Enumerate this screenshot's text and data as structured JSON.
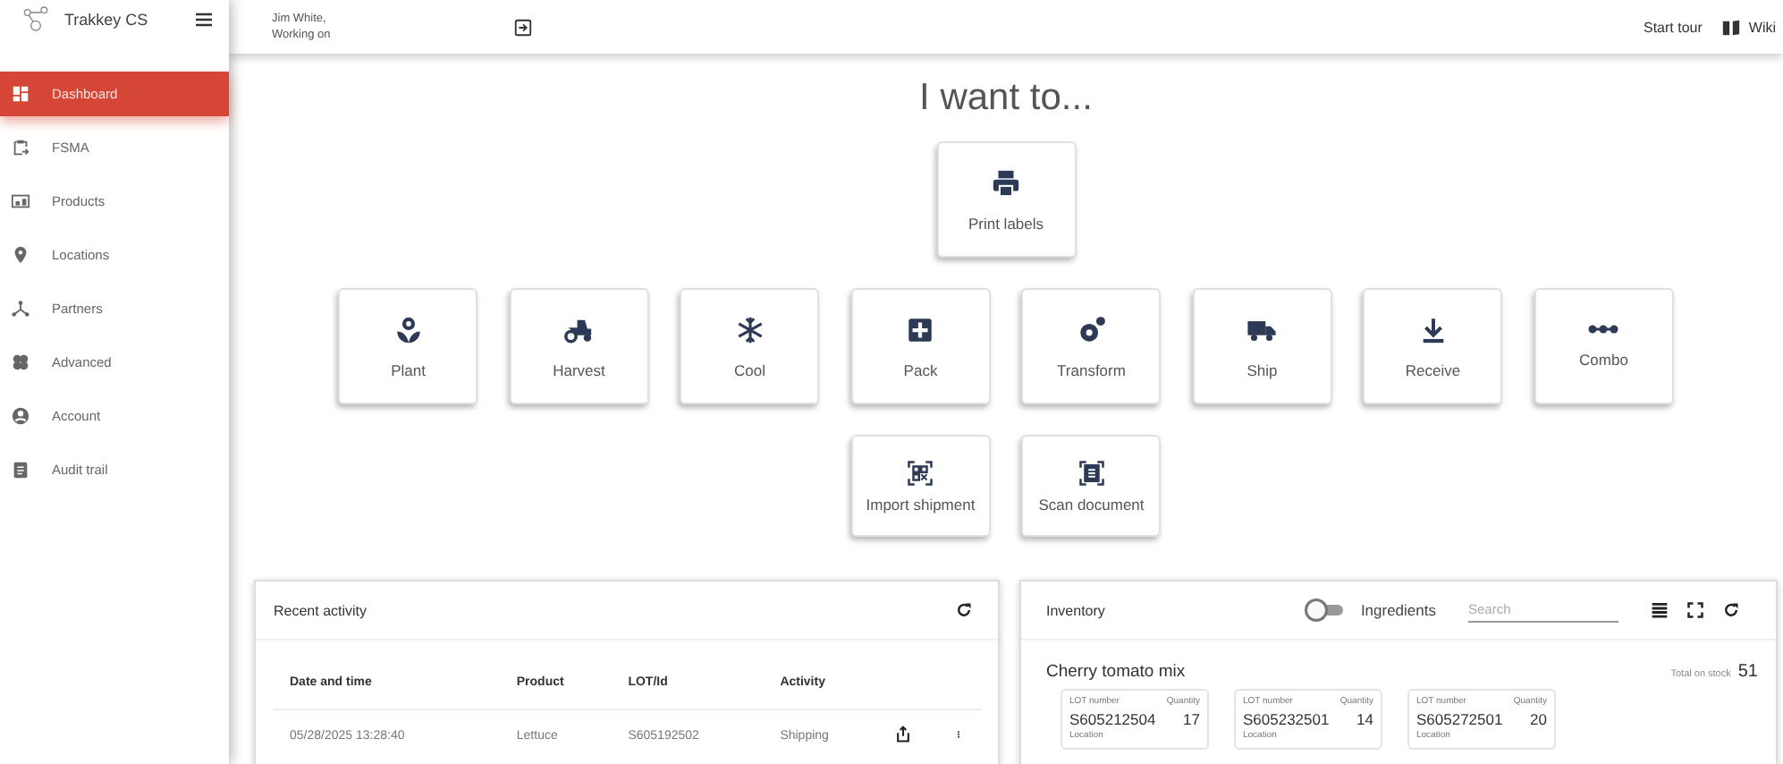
{
  "app": {
    "name": "Trakkey CS"
  },
  "sidebar": {
    "items": [
      {
        "label": "Dashboard",
        "selected": true
      },
      {
        "label": "FSMA",
        "selected": false
      },
      {
        "label": "Products",
        "selected": false
      },
      {
        "label": "Locations",
        "selected": false
      },
      {
        "label": "Partners",
        "selected": false
      },
      {
        "label": "Advanced",
        "selected": false
      },
      {
        "label": "Account",
        "selected": false
      },
      {
        "label": "Audit trail",
        "selected": false
      }
    ]
  },
  "topbar": {
    "user": "Jim White,",
    "workspace": "Working on",
    "links": [
      "Start tour",
      "Wiki"
    ]
  },
  "heading": "I want to...",
  "actions": [
    [
      {
        "label": "Print labels"
      }
    ],
    [
      {
        "label": "Plant"
      },
      {
        "label": "Harvest"
      },
      {
        "label": "Cool"
      },
      {
        "label": "Pack"
      },
      {
        "label": "Transform"
      },
      {
        "label": "Ship"
      },
      {
        "label": "Receive"
      },
      {
        "label": "Combo"
      }
    ],
    [
      {
        "label": "Import shipment"
      },
      {
        "label": "Scan document"
      }
    ]
  ],
  "recent_activity": {
    "title": "Recent activity",
    "columns": [
      "Date and time",
      "Product",
      "LOT/Id",
      "Activity"
    ],
    "rows": [
      {
        "cells": [
          "05/28/2025 13:28:40",
          "Lettuce",
          "S605192502",
          "Shipping"
        ]
      }
    ]
  },
  "inventory": {
    "title": "Inventory",
    "ingredients_toggle": {
      "label": "Ingredients",
      "on": false
    },
    "search": {
      "placeholder": "Search"
    },
    "product": "Cherry tomato mix",
    "total_label": "Total on stock",
    "total": "51",
    "lots": [
      {
        "lot_label": "LOT number",
        "quantity_label": "Quantity",
        "lot": "S605212504",
        "quantity": "17",
        "location_label": "Location"
      },
      {
        "lot_label": "LOT number",
        "quantity_label": "Quantity",
        "lot": "S605232501",
        "quantity": "14",
        "location_label": "Location"
      },
      {
        "lot_label": "LOT number",
        "quantity_label": "Quantity",
        "lot": "S605272501",
        "quantity": "20",
        "location_label": "Location"
      }
    ]
  }
}
